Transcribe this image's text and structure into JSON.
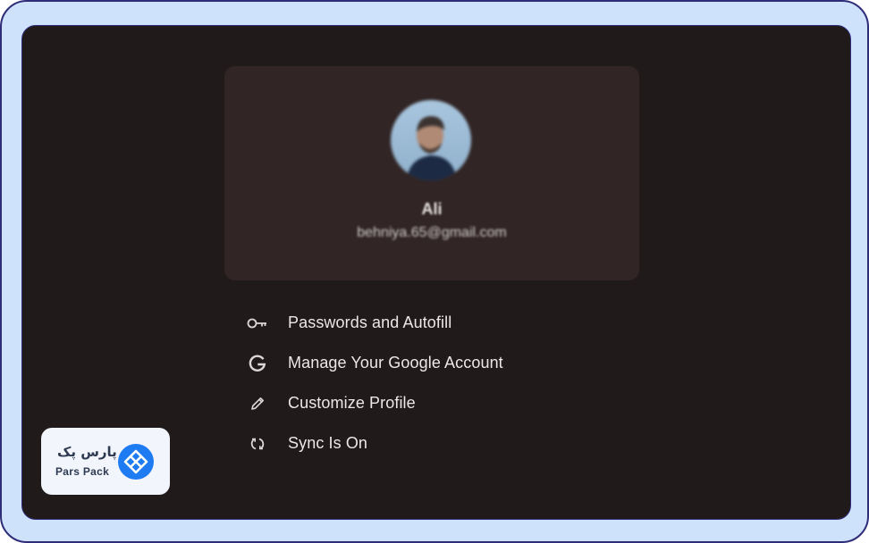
{
  "profile": {
    "name": "Ali",
    "email": "behniya.65@gmail.com"
  },
  "menu": {
    "items": [
      {
        "label": "Passwords and Autofill",
        "icon": "key-icon"
      },
      {
        "label": "Manage Your Google Account",
        "icon": "google-icon"
      },
      {
        "label": "Customize Profile",
        "icon": "pencil-icon"
      },
      {
        "label": "Sync Is On",
        "icon": "sync-icon"
      }
    ]
  },
  "watermark": {
    "brand_fa": "پارس پک",
    "brand_en": "Pars Pack"
  },
  "colors": {
    "frame_background": "#cfe2fb",
    "frame_border": "#2f2c7a",
    "screen_background": "#201a1a",
    "card_background": "#312525",
    "text_primary": "#ece8e8",
    "brand_blue": "#1e7bf2"
  }
}
